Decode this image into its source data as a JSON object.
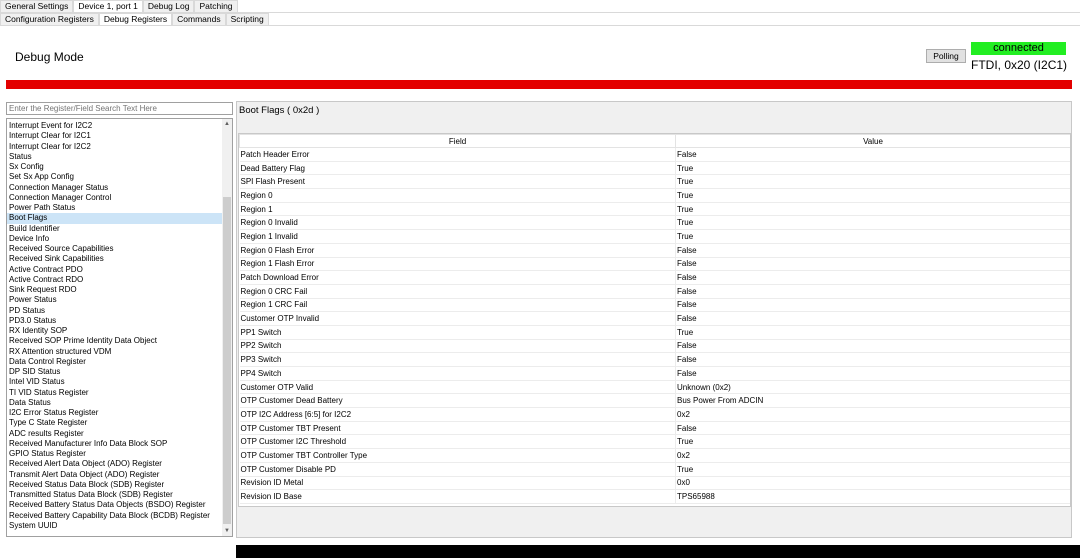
{
  "top_tabs": [
    "General Settings",
    "Device 1, port 1",
    "Debug Log",
    "Patching"
  ],
  "top_tabs_active": 1,
  "sub_tabs": [
    "Configuration Registers",
    "Debug Registers",
    "Commands",
    "Scripting"
  ],
  "sub_tabs_active": 1,
  "page_title": "Debug Mode",
  "polling_button": "Polling",
  "connection": {
    "status": "connected",
    "status_color": "#22ee22",
    "info": "FTDI, 0x20 (I2C1)"
  },
  "alert_bar_color": "#e30000",
  "search": {
    "placeholder": "Enter the Register/Field Search Text Here",
    "value": ""
  },
  "register_list": {
    "selected_index": 9,
    "items": [
      "Interrupt Event for I2C2",
      "Interrupt Clear for I2C1",
      "Interrupt Clear for I2C2",
      "Status",
      "Sx Config",
      "Set Sx App Config",
      "Connection Manager Status",
      "Connection Manager Control",
      "Power Path Status",
      "Boot Flags",
      "Build Identifier",
      "Device Info",
      "Received Source Capabilities",
      "Received Sink Capabilities",
      "Active Contract PDO",
      "Active Contract RDO",
      "Sink Request RDO",
      "Power Status",
      "PD Status",
      "PD3.0 Status",
      "RX Identity SOP",
      "Received SOP Prime Identity Data Object",
      "RX Attention structured VDM",
      "Data Control Register",
      "DP SID Status",
      "Intel VID Status",
      "TI VID Status Register",
      "Data Status",
      "I2C Error Status Register",
      "Type C State Register",
      "ADC results Register",
      "Received Manufacturer Info Data Block SOP",
      "GPIO Status Register",
      "Received Alert Data Object (ADO) Register",
      "Transmit Alert Data Object (ADO) Register",
      "Received Status Data Block (SDB) Register",
      "Transmitted Status Data Block (SDB) Register",
      "Received Battery Status Data Objects (BSDO) Register",
      "Received Battery Capability Data Block (BCDB) Register",
      "System UUID"
    ]
  },
  "register_detail": {
    "title": "Boot Flags  ( 0x2d )",
    "columns": [
      "Field",
      "Value"
    ],
    "rows": [
      [
        "Patch Header Error",
        "False"
      ],
      [
        "Dead Battery Flag",
        "True"
      ],
      [
        "SPI Flash Present",
        "True"
      ],
      [
        "Region 0",
        "True"
      ],
      [
        "Region 1",
        "True"
      ],
      [
        "Region 0 Invalid",
        "True"
      ],
      [
        "Region 1 Invalid",
        "True"
      ],
      [
        "Region 0 Flash Error",
        "False"
      ],
      [
        "Region 1 Flash Error",
        "False"
      ],
      [
        "Patch Download Error",
        "False"
      ],
      [
        "Region 0 CRC Fail",
        "False"
      ],
      [
        "Region 1 CRC Fail",
        "False"
      ],
      [
        "Customer OTP Invalid",
        "False"
      ],
      [
        "PP1 Switch",
        "True"
      ],
      [
        "PP2 Switch",
        "False"
      ],
      [
        "PP3 Switch",
        "False"
      ],
      [
        "PP4 Switch",
        "False"
      ],
      [
        "Customer OTP Valid",
        "Unknown (0x2)"
      ],
      [
        "OTP Customer Dead Battery",
        "Bus Power From ADCIN"
      ],
      [
        "OTP I2C Address [6:5] for I2C2",
        "0x2"
      ],
      [
        "OTP Customer TBT Present",
        "False"
      ],
      [
        "OTP Customer I2C Threshold",
        "True"
      ],
      [
        "OTP Customer TBT Controller Type",
        "0x2"
      ],
      [
        "OTP Customer Disable PD",
        "True"
      ],
      [
        "Revision ID Metal",
        "0x0"
      ],
      [
        "Revision ID Base",
        "TPS65988"
      ]
    ]
  }
}
